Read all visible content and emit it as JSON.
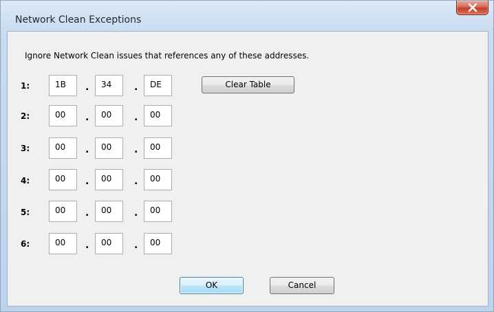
{
  "window": {
    "title": "Network Clean Exceptions"
  },
  "instruction": "Ignore Network Clean issues that references any of these addresses.",
  "rows": [
    {
      "label": "1:",
      "octets": [
        "1B",
        "34",
        "DE"
      ]
    },
    {
      "label": "2:",
      "octets": [
        "00",
        "00",
        "00"
      ]
    },
    {
      "label": "3:",
      "octets": [
        "00",
        "00",
        "00"
      ]
    },
    {
      "label": "4:",
      "octets": [
        "00",
        "00",
        "00"
      ]
    },
    {
      "label": "5:",
      "octets": [
        "00",
        "00",
        "00"
      ]
    },
    {
      "label": "6:",
      "octets": [
        "00",
        "00",
        "00"
      ]
    }
  ],
  "separator": ".",
  "buttons": {
    "clear_table": "Clear Table",
    "ok": "OK",
    "cancel": "Cancel"
  },
  "colors": {
    "close_button": "#c23f2a",
    "default_button_border": "#3c7fb1"
  }
}
